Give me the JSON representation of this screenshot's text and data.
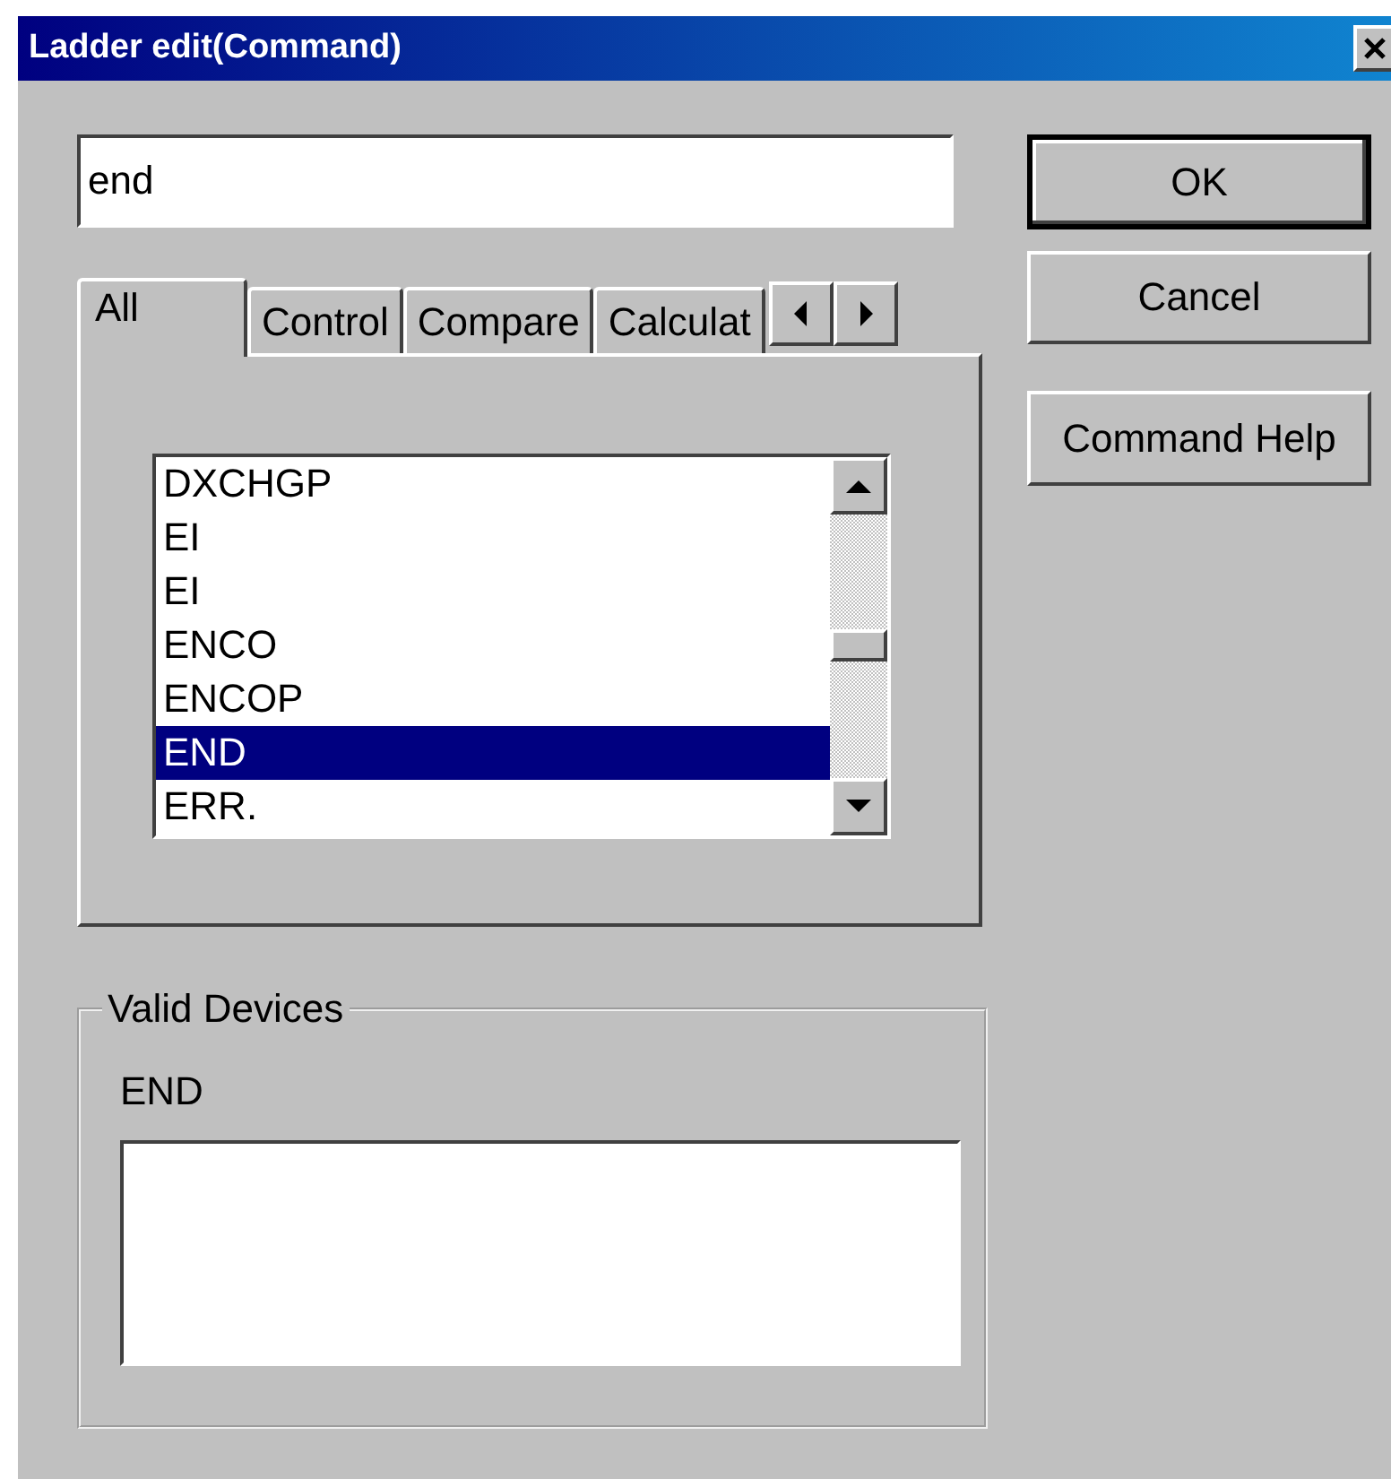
{
  "window": {
    "title": "Ladder edit(Command)"
  },
  "command_field": {
    "value": "end"
  },
  "tabs": [
    {
      "label": "All",
      "selected": true
    },
    {
      "label": "Control",
      "selected": false
    },
    {
      "label": "Compare",
      "selected": false
    },
    {
      "label": "Calculat",
      "selected": false
    }
  ],
  "commands": [
    {
      "label": "DXCHGP",
      "selected": false
    },
    {
      "label": "EI",
      "selected": false
    },
    {
      "label": "EI",
      "selected": false
    },
    {
      "label": "ENCO",
      "selected": false
    },
    {
      "label": "ENCOP",
      "selected": false
    },
    {
      "label": "END",
      "selected": true
    },
    {
      "label": "ERR.",
      "selected": false
    }
  ],
  "buttons": [
    "OK",
    "Cancel",
    "Command Help"
  ],
  "valid_devices": {
    "title": "Valid Devices",
    "command": "END"
  }
}
